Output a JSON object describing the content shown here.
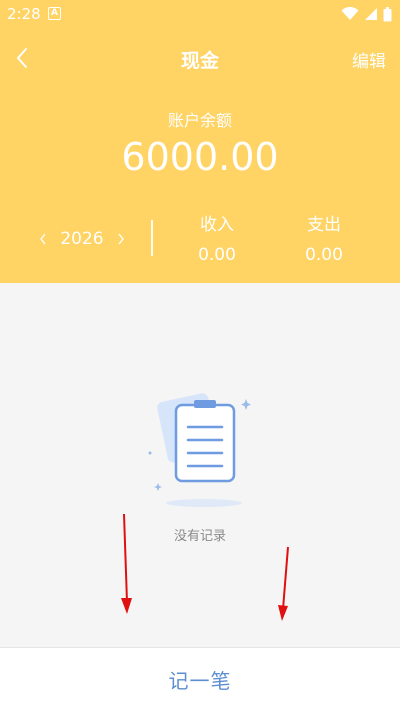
{
  "status_bar": {
    "time": "2:28",
    "notification_icon": "A",
    "icons": [
      "wifi-icon",
      "signal-icon",
      "battery-icon"
    ]
  },
  "navbar": {
    "title": "现金",
    "edit_label": "编辑",
    "back_icon": "chevron-left-icon"
  },
  "account": {
    "balance_label": "账户余额",
    "balance_value": "6000.00"
  },
  "period": {
    "year": "2026",
    "prev_icon": "chevron-left-icon",
    "next_icon": "chevron-right-icon"
  },
  "summary": {
    "income_label": "收入",
    "income_value": "0.00",
    "expense_label": "支出",
    "expense_value": "0.00"
  },
  "empty_state": {
    "text": "没有记录",
    "illustration": "clipboard-icon"
  },
  "bottom": {
    "add_label": "记一笔"
  },
  "colors": {
    "header_bg": "#ffd364",
    "page_bg": "#f5f5f5",
    "accent_blue": "#5d8ecf",
    "annotation_red": "#e01010"
  }
}
